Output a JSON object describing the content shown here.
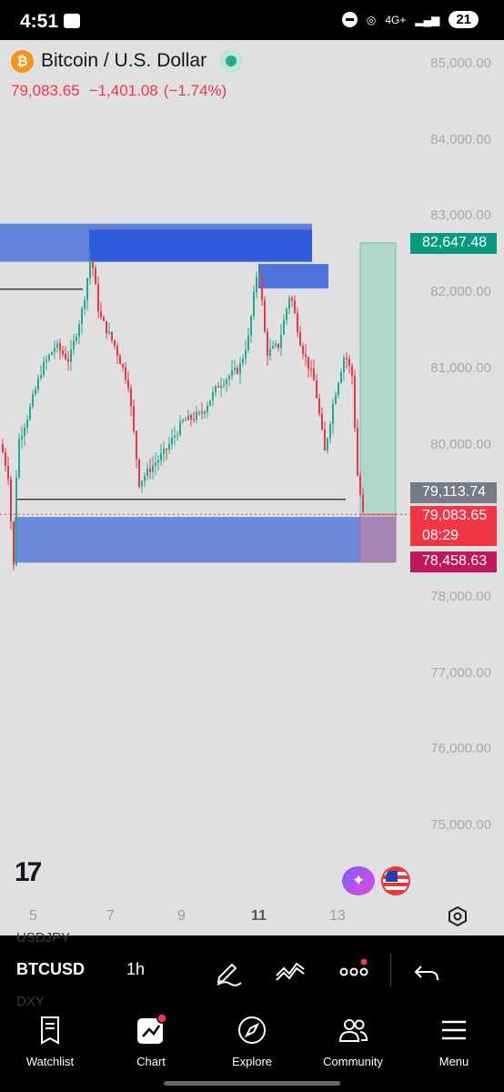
{
  "status_bar": {
    "time": "4:51",
    "network": "4G+",
    "battery": "21"
  },
  "header": {
    "symbol_name": "Bitcoin / U.S. Dollar",
    "last_price": "79,083.65",
    "change": "−1,401.08",
    "change_pct": "(−1.74%)",
    "icon": "bitcoin-icon"
  },
  "chart_data": {
    "type": "candlestick",
    "symbol": "BTCUSD",
    "interval": "1h",
    "y_axis": [
      "85,000.00",
      "84,000.00",
      "83,000.00",
      "82,000.00",
      "81,000.00",
      "80,000.00",
      "78,000.00",
      "77,000.00",
      "76,000.00",
      "75,000.00"
    ],
    "x_axis": [
      "5",
      "7",
      "9",
      "11",
      "13"
    ],
    "ylim": [
      74800,
      85300
    ],
    "price_tags": [
      {
        "label": "82,647.48",
        "color": "#089981"
      },
      {
        "label": "79,113.74",
        "color": "#787b86"
      },
      {
        "label": "79,083.65",
        "sublabel": "08:29",
        "color": "#f23645"
      },
      {
        "label": "78,458.63",
        "color": "#c2185b"
      }
    ],
    "zones": [
      {
        "name": "supply-zone-1",
        "from": 82400,
        "to": 82900
      },
      {
        "name": "supply-zone-2",
        "from": 82400,
        "to": 82820
      },
      {
        "name": "supply-zone-3",
        "from": 82050,
        "to": 82370
      },
      {
        "name": "demand-zone",
        "from": 78450,
        "to": 79050
      }
    ],
    "lines": [
      {
        "name": "resistance-line",
        "value": 82040
      },
      {
        "name": "support-line",
        "value": 79280
      }
    ],
    "position": {
      "entry": 79083.65,
      "target": 82647.48,
      "stop": 78458.63
    }
  },
  "toolbar": {
    "ghost_above": "USDJPY",
    "symbol": "BTCUSD",
    "interval": "1h",
    "ghost_below": "DXY"
  },
  "nav": [
    {
      "label": "Watchlist",
      "icon": "watchlist-icon"
    },
    {
      "label": "Chart",
      "icon": "chart-icon"
    },
    {
      "label": "Explore",
      "icon": "compass-icon"
    },
    {
      "label": "Community",
      "icon": "community-icon"
    },
    {
      "label": "Menu",
      "icon": "menu-icon"
    }
  ],
  "colors": {
    "up": "#22ab94",
    "down": "#f23645",
    "zone": "#1e4fd8",
    "accent": "#f7931a"
  }
}
